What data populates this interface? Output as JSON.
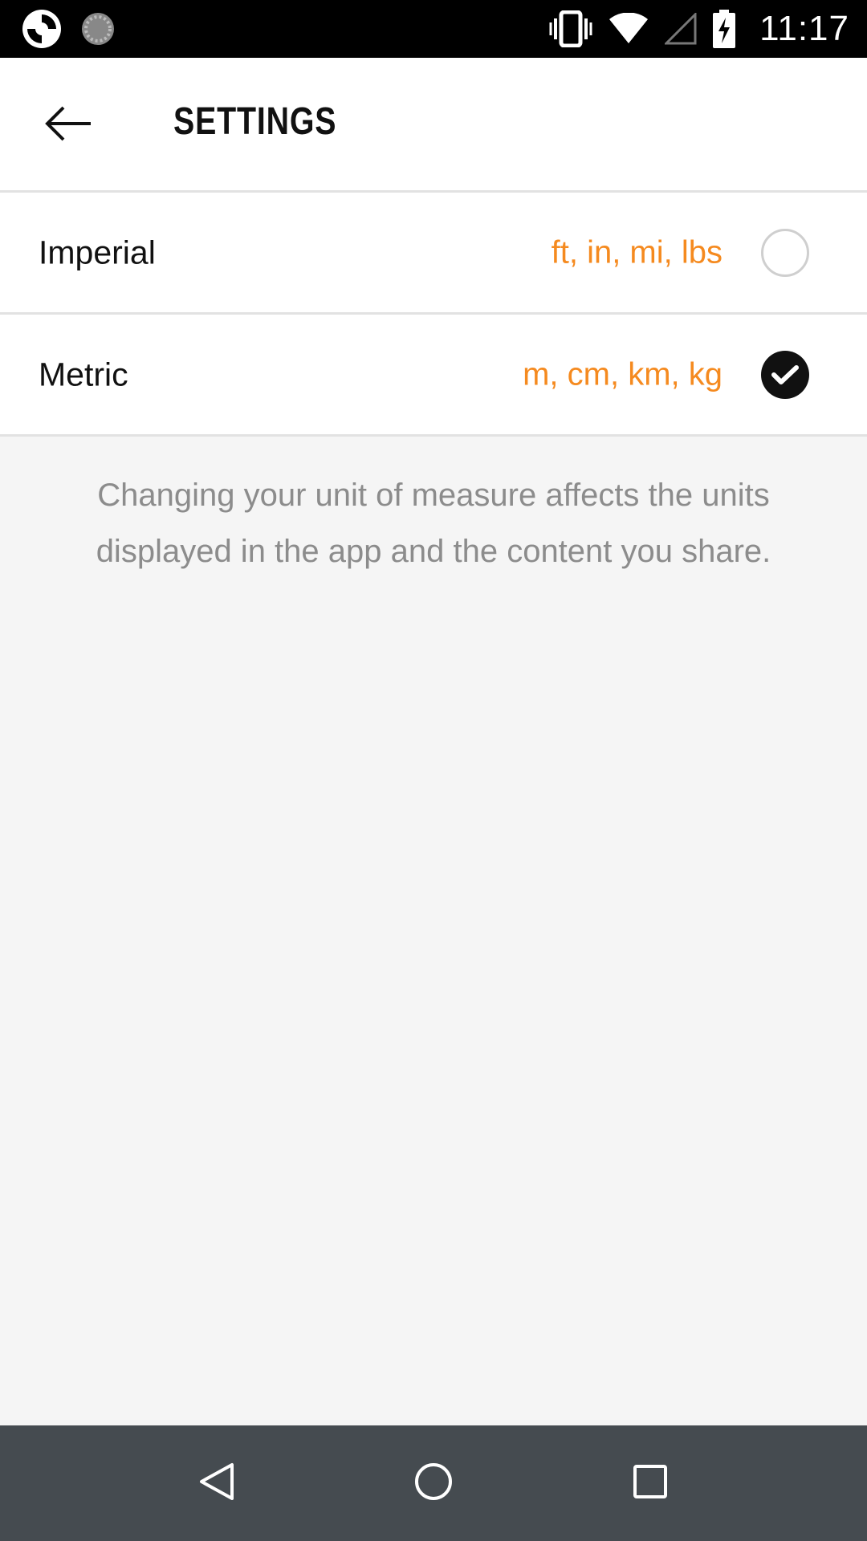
{
  "status_bar": {
    "time": "11:17",
    "icons": [
      "app-notification-icon",
      "sync-notification-icon",
      "vibrate-icon",
      "wifi-icon",
      "cellular-signal-icon",
      "battery-charging-icon"
    ]
  },
  "app_bar": {
    "title": "SETTINGS",
    "back_icon": "arrow-left-icon"
  },
  "unit_options": [
    {
      "label": "Imperial",
      "units": "ft, in, mi, lbs",
      "selected": false
    },
    {
      "label": "Metric",
      "units": "m, cm, km, kg",
      "selected": true
    }
  ],
  "description": "Changing your unit of measure affects the units displayed in the app and the content you share.",
  "nav_bar": {
    "icons": [
      "nav-back-icon",
      "nav-home-icon",
      "nav-recents-icon"
    ]
  },
  "colors": {
    "accent_units": "#f58a1f",
    "status_bar": "#000000",
    "nav_bar": "#454b50",
    "background": "#f5f5f5"
  }
}
